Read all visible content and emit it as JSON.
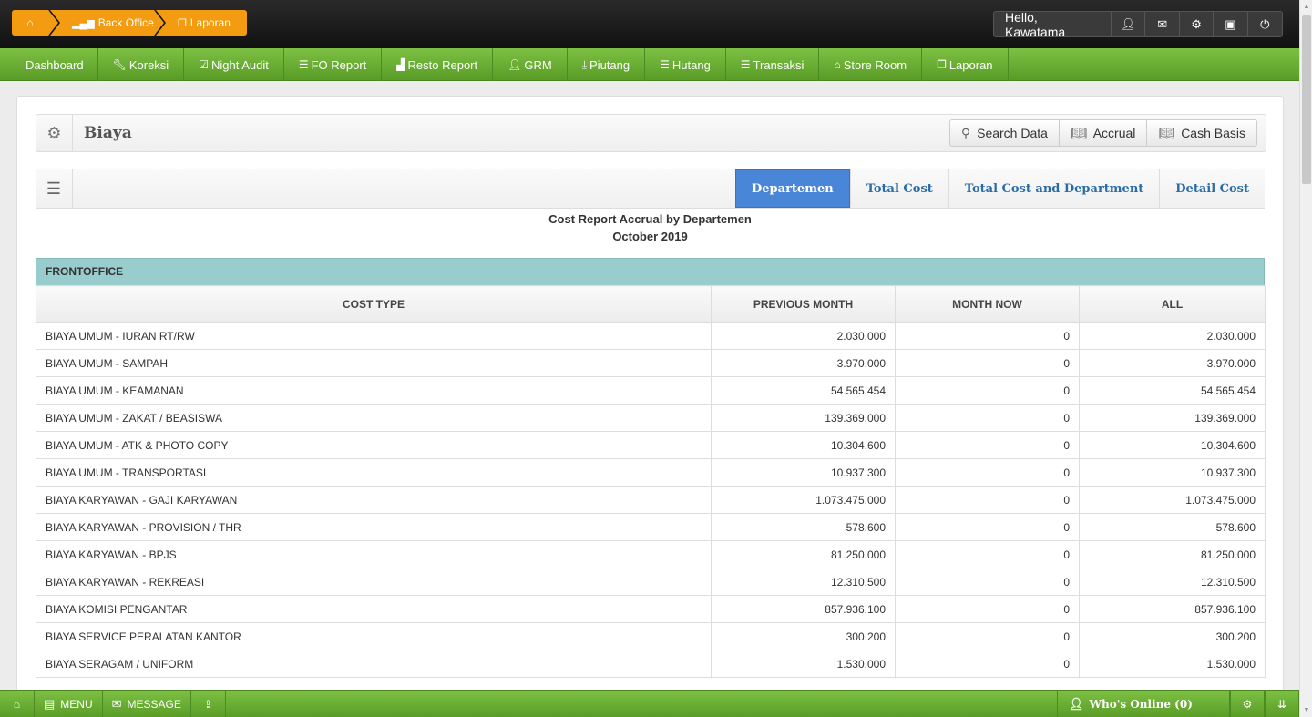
{
  "breadcrumb": {
    "home_icon": "home-icon",
    "items": [
      {
        "label": "Back Office",
        "icon": "signal-icon"
      },
      {
        "label": "Laporan",
        "icon": "document-icon"
      }
    ]
  },
  "user": {
    "greeting": "Hello, Kawatama",
    "buttons": [
      "user-icon",
      "mail-icon",
      "gear-icon",
      "briefcase-icon",
      "power-icon"
    ]
  },
  "nav": [
    {
      "label": "Dashboard",
      "icon": ""
    },
    {
      "label": "Koreksi",
      "icon": "wrench-icon"
    },
    {
      "label": "Night Audit",
      "icon": "check-square-icon"
    },
    {
      "label": "FO Report",
      "icon": "list-icon"
    },
    {
      "label": "Resto Report",
      "icon": "chart-icon"
    },
    {
      "label": "GRM",
      "icon": "user-icon"
    },
    {
      "label": "Piutang",
      "icon": "download-icon"
    },
    {
      "label": "Hutang",
      "icon": "list-icon"
    },
    {
      "label": "Transaksi",
      "icon": "list-icon"
    },
    {
      "label": "Store Room",
      "icon": "bank-icon"
    },
    {
      "label": "Laporan",
      "icon": "document-icon"
    }
  ],
  "page": {
    "title": "Biaya",
    "buttons": {
      "search": "Search Data",
      "accrual": "Accrual",
      "cash_basis": "Cash Basis"
    }
  },
  "tabs": [
    "Departemen",
    "Total Cost",
    "Total Cost and Department",
    "Detail Cost"
  ],
  "active_tab": "Departemen",
  "report": {
    "title": "Cost Report Accrual by Departemen",
    "period": "October 2019"
  },
  "section": "FRONTOFFICE",
  "table": {
    "headers": [
      "COST TYPE",
      "PREVIOUS MONTH",
      "MONTH NOW",
      "ALL"
    ],
    "rows": [
      [
        "BIAYA UMUM - IURAN RT/RW",
        "2.030.000",
        "0",
        "2.030.000"
      ],
      [
        "BIAYA UMUM - SAMPAH",
        "3.970.000",
        "0",
        "3.970.000"
      ],
      [
        "BIAYA UMUM - KEAMANAN",
        "54.565.454",
        "0",
        "54.565.454"
      ],
      [
        "BIAYA UMUM - ZAKAT / BEASISWA",
        "139.369.000",
        "0",
        "139.369.000"
      ],
      [
        "BIAYA UMUM - ATK & PHOTO COPY",
        "10.304.600",
        "0",
        "10.304.600"
      ],
      [
        "BIAYA UMUM - TRANSPORTASI",
        "10.937.300",
        "0",
        "10.937.300"
      ],
      [
        "BIAYA KARYAWAN - GAJI KARYAWAN",
        "1.073.475.000",
        "0",
        "1.073.475.000"
      ],
      [
        "BIAYA KARYAWAN - PROVISION / THR",
        "578.600",
        "0",
        "578.600"
      ],
      [
        "BIAYA KARYAWAN - BPJS",
        "81.250.000",
        "0",
        "81.250.000"
      ],
      [
        "BIAYA KARYAWAN - REKREASI",
        "12.310.500",
        "0",
        "12.310.500"
      ],
      [
        "BIAYA KOMISI PENGANTAR",
        "857.936.100",
        "0",
        "857.936.100"
      ],
      [
        "BIAYA SERVICE PERALATAN KANTOR",
        "300.200",
        "0",
        "300.200"
      ],
      [
        "BIAYA SERAGAM / UNIFORM",
        "1.530.000",
        "0",
        "1.530.000"
      ]
    ]
  },
  "footer": {
    "menu": "MENU",
    "message": "MESSAGE",
    "online": "Who's Online (0)"
  }
}
